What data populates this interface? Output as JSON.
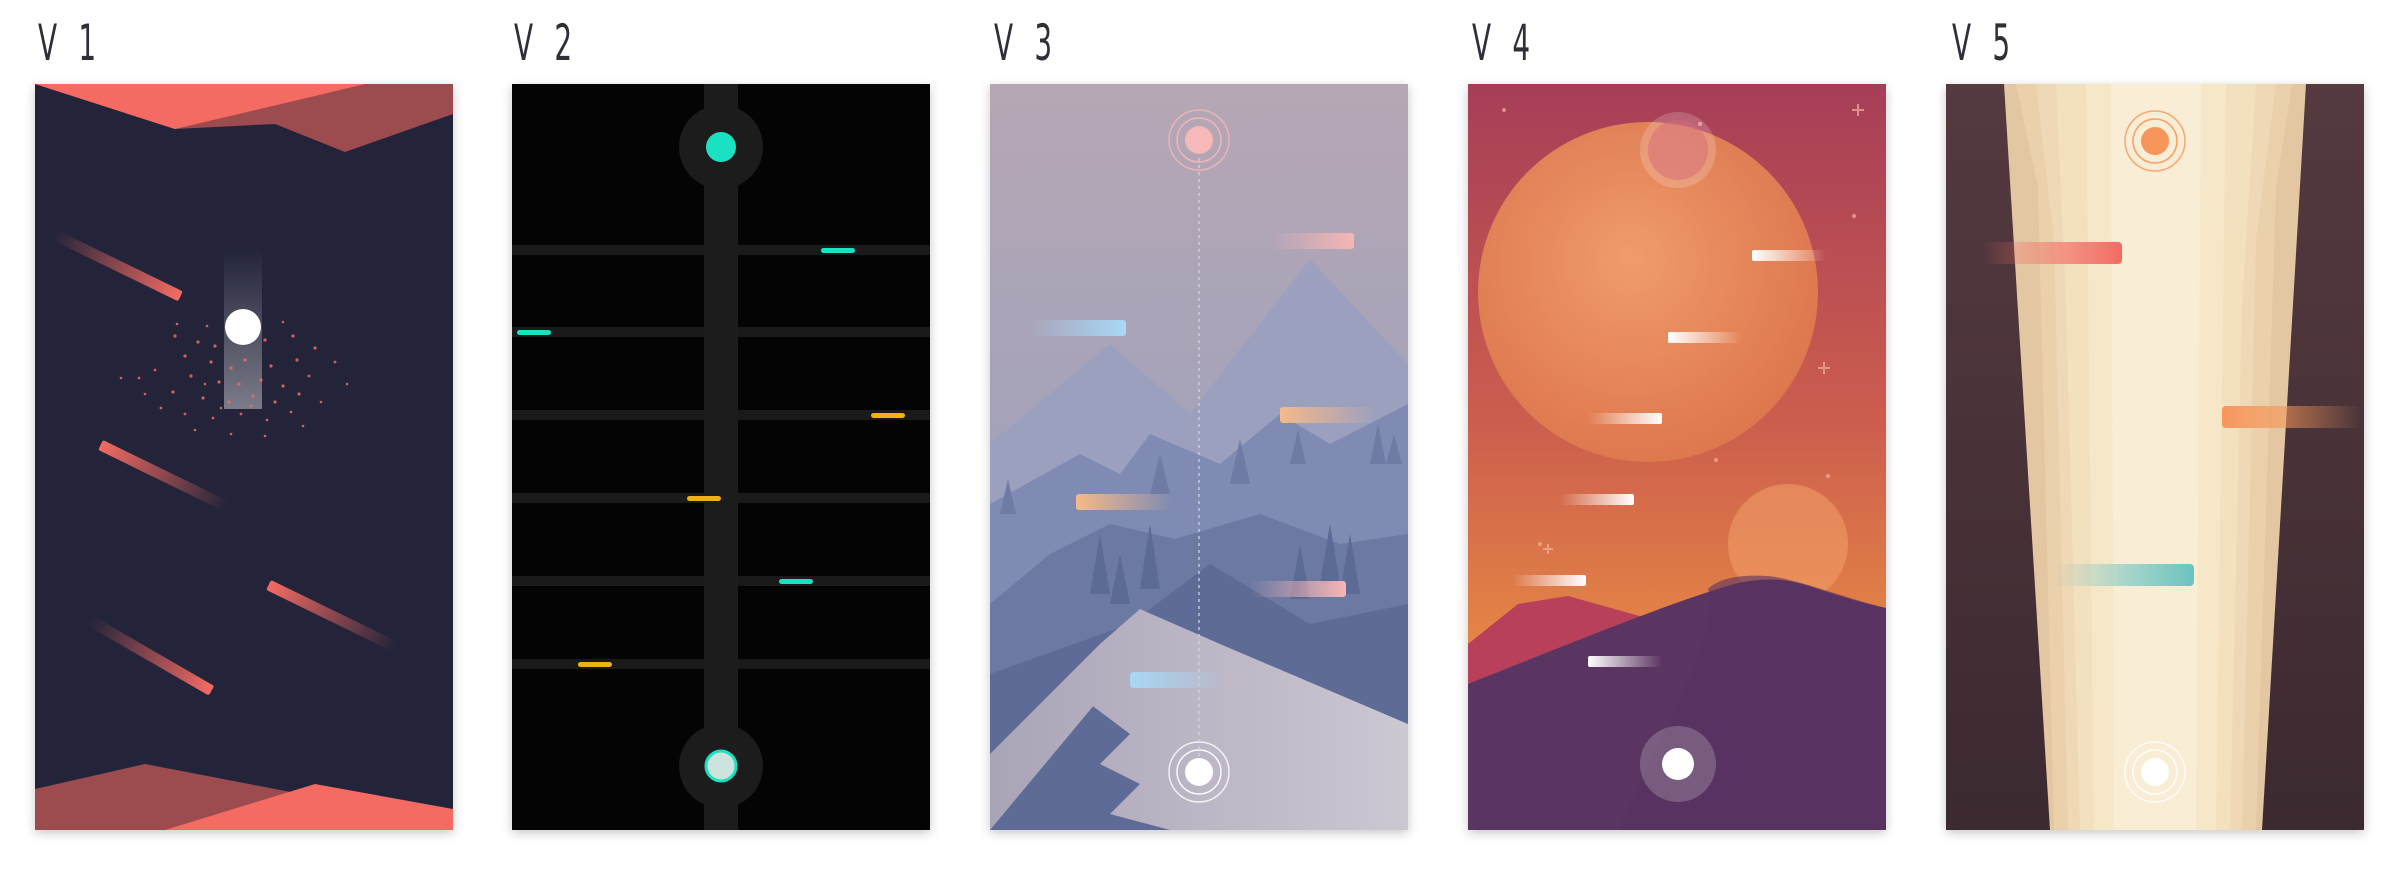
{
  "variants": [
    {
      "label": "V 1",
      "theme": "dark-coral",
      "colors": {
        "bg": "#23243a",
        "accent": "#f46b63"
      }
    },
    {
      "label": "V 2",
      "theme": "black-neon",
      "colors": {
        "bg": "#040404",
        "accent": "#1be1c3",
        "secondary": "#f0b118"
      }
    },
    {
      "label": "V 3",
      "theme": "misty-mountains",
      "colors": {
        "bg": "#a8a3b7",
        "accent": "#f5b8b8"
      }
    },
    {
      "label": "V 4",
      "theme": "sunset-planet",
      "colors": {
        "bg": "#a64158",
        "accent": "#ef8c4b"
      }
    },
    {
      "label": "V 5",
      "theme": "warm-light-beam",
      "colors": {
        "bg": "#4a3438",
        "accent": "#f6965a"
      }
    }
  ]
}
